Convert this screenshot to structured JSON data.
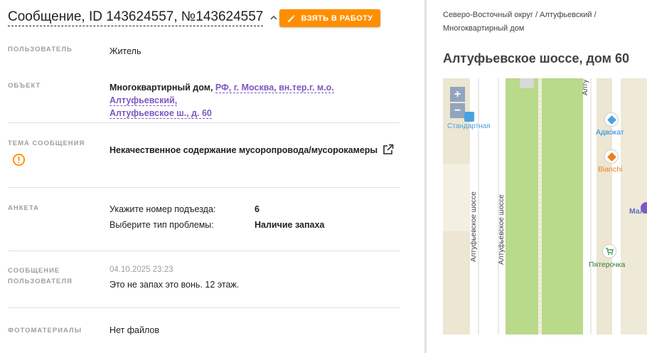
{
  "header": {
    "title": "Сообщение, ID 143624557, №143624557",
    "take_button_label": "ВЗЯТЬ В РАБОТУ"
  },
  "fields": {
    "user": {
      "label": "ПОЛЬЗОВАТЕЛЬ",
      "value": "Житель"
    },
    "object": {
      "label": "ОБЪЕКТ",
      "type": "Многоквартирный дом,",
      "address_line1": "РФ, г. Москва, вн.тер.г. м.о. Алтуфьевский,",
      "address_line2": "Алтуфьевское ш., д. 60"
    },
    "topic": {
      "label": "ТЕМА СООБЩЕНИЯ",
      "value": "Некачественное содержание мусоропровода/мусорокамеры"
    },
    "survey": {
      "label": "АНКЕТА",
      "items": [
        {
          "question": "Укажите номер подъезда:",
          "answer": "6"
        },
        {
          "question": "Выберите тип проблемы:",
          "answer": "Наличие запаха"
        }
      ]
    },
    "user_message": {
      "label_line1": "СООБЩЕНИЕ",
      "label_line2": "ПОЛЬЗОВАТЕЛЯ",
      "date": "04.10.2025 23:23",
      "text": "Это не запах это вонь. 12 этаж."
    },
    "photos": {
      "label": "ФОТОМАТЕРИАЛЫ",
      "value": "Нет файлов"
    }
  },
  "right_panel": {
    "breadcrumb_line1": "Северо-Восточный округ / Алтуфьевский /",
    "breadcrumb_line2": "Многоквартирный дом",
    "address_title": "Алтуфьевское шоссе, дом 60",
    "map": {
      "zoom_in": "+",
      "zoom_out": "−",
      "road_left": "Алтуфьевское шоссе",
      "road_right": "Алтуфьевское шоссе",
      "road_top_partial": "Алту",
      "poi_standard": "Стандартная",
      "poi_advokat": "Адвокат",
      "poi_bianchi": "Bianchi",
      "poi_pyaterochka": "Пятерочка",
      "poi_partial": "Мал"
    }
  },
  "colors": {
    "accent_orange": "#ff8f00",
    "link_purple": "#7e57c2",
    "label_gray": "#9e9e9e",
    "map_green": "#b9d98b",
    "map_background": "#f3efe1"
  },
  "icons": {
    "chevron": "chevron-up-icon",
    "edit": "pencil-icon",
    "external": "open-in-new-icon",
    "warning": "warning-circle-icon"
  }
}
